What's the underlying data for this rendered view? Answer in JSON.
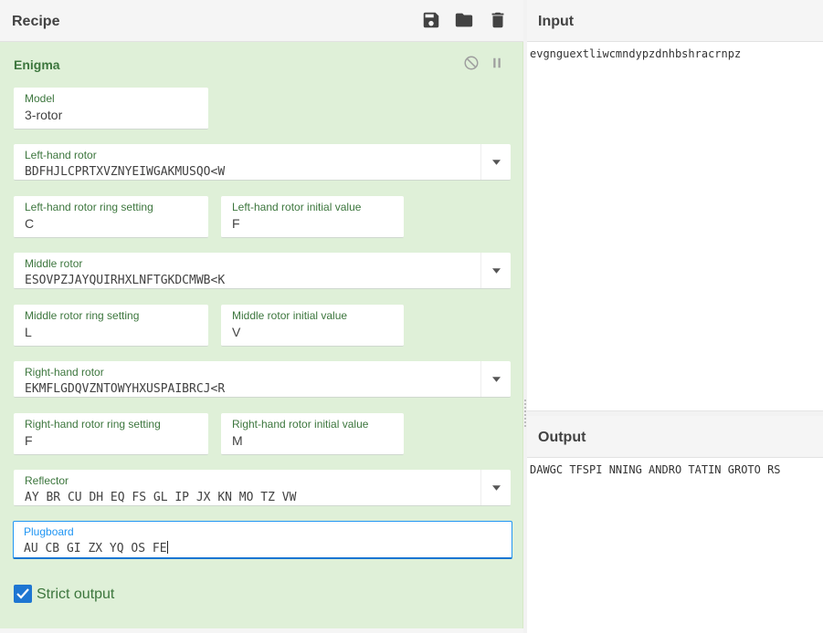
{
  "recipe": {
    "title": "Recipe",
    "icons": [
      "save-icon",
      "folder-icon",
      "trash-icon"
    ]
  },
  "operation": {
    "title": "Enigma",
    "icons": [
      "disable-icon",
      "pause-icon"
    ],
    "model": {
      "label": "Model",
      "value": "3-rotor"
    },
    "left_rotor": {
      "label": "Left-hand rotor",
      "value": "BDFHJLCPRTXVZNYEIWGAKMUSQO<W"
    },
    "left_ring": {
      "label": "Left-hand rotor ring setting",
      "value": "C"
    },
    "left_initial": {
      "label": "Left-hand rotor initial value",
      "value": "F"
    },
    "middle_rotor": {
      "label": "Middle rotor",
      "value": "ESOVPZJAYQUIRHXLNFTGKDCMWB<K"
    },
    "middle_ring": {
      "label": "Middle rotor ring setting",
      "value": "L"
    },
    "middle_initial": {
      "label": "Middle rotor initial value",
      "value": "V"
    },
    "right_rotor": {
      "label": "Right-hand rotor",
      "value": "EKMFLGDQVZNTOWYHXUSPAIBRCJ<R"
    },
    "right_ring": {
      "label": "Right-hand rotor ring setting",
      "value": "F"
    },
    "right_initial": {
      "label": "Right-hand rotor initial value",
      "value": "M"
    },
    "reflector": {
      "label": "Reflector",
      "value": "AY BR CU DH EQ FS GL IP JX KN MO TZ VW"
    },
    "plugboard": {
      "label": "Plugboard",
      "value": "AU CB GI ZX YQ OS FE"
    },
    "strict_output": {
      "label": "Strict output",
      "checked": true
    }
  },
  "input": {
    "title": "Input",
    "text": "evgnguextliwcmndypzdnhbshracrnpz"
  },
  "output": {
    "title": "Output",
    "text": "DAWGC TFSPI NNING ANDRO TATIN GROTO RS"
  },
  "colors": {
    "operation_bg": "#dff0d8",
    "label_green": "#3c763d",
    "active_blue": "#2196f3",
    "checkbox_blue": "#1e76d2"
  }
}
